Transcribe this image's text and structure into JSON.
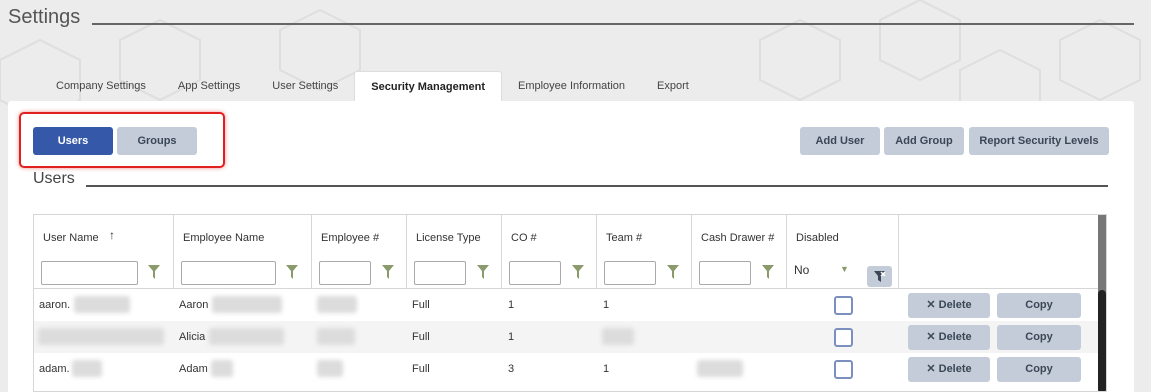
{
  "page": {
    "title": "Settings"
  },
  "tabs": [
    {
      "label": "Company Settings",
      "active": false
    },
    {
      "label": "App Settings",
      "active": false
    },
    {
      "label": "User Settings",
      "active": false
    },
    {
      "label": "Security Management",
      "active": true
    },
    {
      "label": "Employee Information",
      "active": false
    },
    {
      "label": "Export",
      "active": false
    }
  ],
  "toggle": {
    "users_label": "Users",
    "groups_label": "Groups"
  },
  "actions": {
    "add_user": "Add User",
    "add_group": "Add Group",
    "report": "Report Security Levels"
  },
  "section": {
    "title": "Users"
  },
  "grid": {
    "columns": [
      "User Name",
      "Employee Name",
      "Employee #",
      "License Type",
      "CO #",
      "Team #",
      "Cash Drawer #",
      "Disabled"
    ],
    "sort_icon": "↑",
    "disabled_filter_value": "No",
    "rows": [
      {
        "user_name": "aaron.",
        "employee_name": "Aaron",
        "license": "Full",
        "co": "1",
        "team": "1",
        "delete_label": "Delete",
        "copy_label": "Copy"
      },
      {
        "user_name": "",
        "employee_name": "Alicia",
        "license": "Full",
        "co": "1",
        "team": "",
        "delete_label": "Delete",
        "copy_label": "Copy"
      },
      {
        "user_name": "adam.",
        "employee_name": "Adam",
        "license": "Full",
        "co": "3",
        "team": "1",
        "delete_label": "Delete",
        "copy_label": "Copy"
      }
    ]
  },
  "colors": {
    "primary": "#3658a8",
    "secondary": "#c3ccd8",
    "highlight": "#e02020",
    "filter_icon": "#8a9a6a"
  }
}
